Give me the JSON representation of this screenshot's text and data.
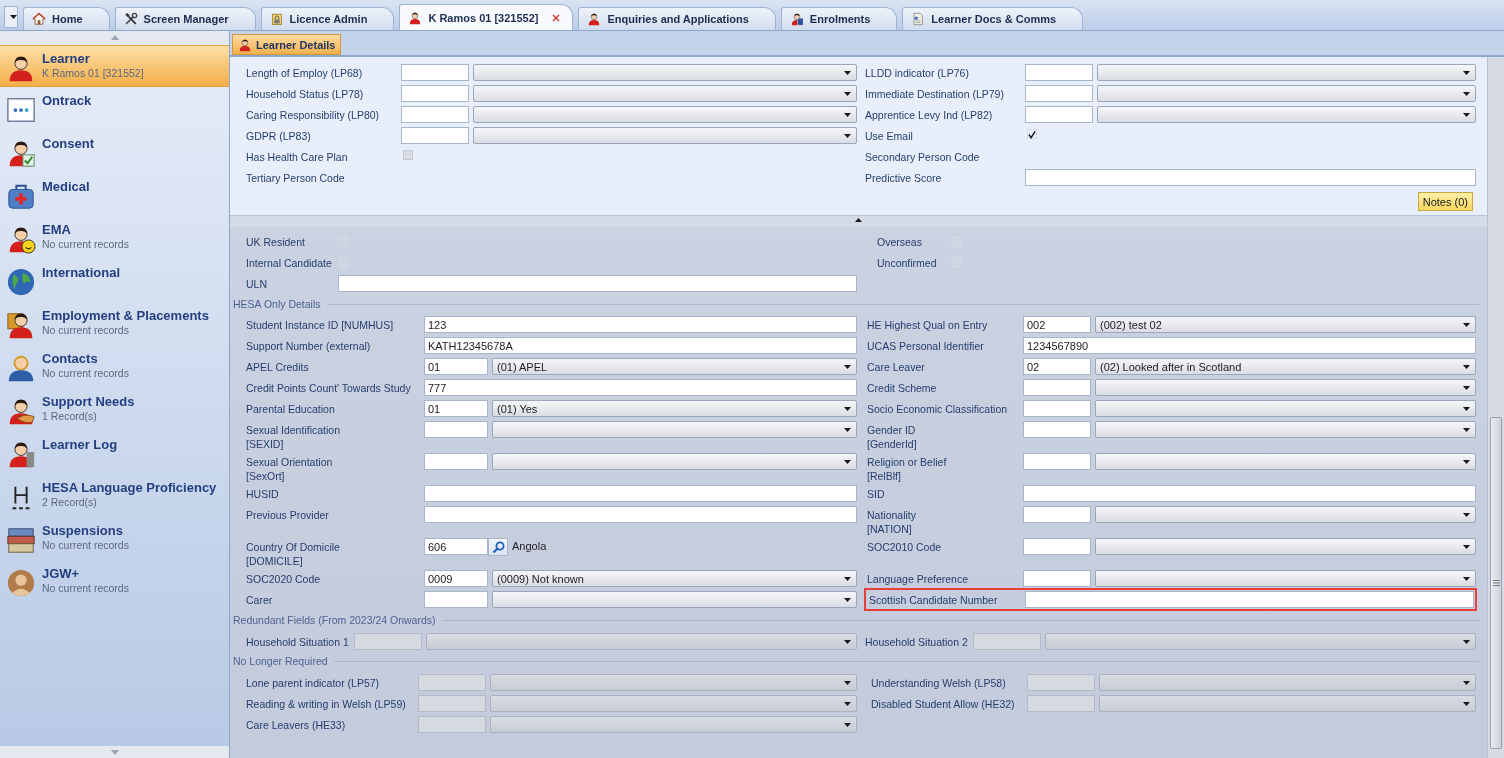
{
  "tab_bar": {
    "tabs": [
      {
        "label": "Home",
        "selected": false,
        "closable": false
      },
      {
        "label": "Screen Manager",
        "selected": false,
        "closable": false
      },
      {
        "label": "Licence Admin",
        "selected": false,
        "closable": false
      },
      {
        "label": "K Ramos 01 [321552]",
        "selected": true,
        "closable": true
      },
      {
        "label": "Enquiries and Applications",
        "selected": false,
        "closable": false
      },
      {
        "label": "Enrolments",
        "selected": false,
        "closable": false
      },
      {
        "label": "Learner Docs & Comms",
        "selected": false,
        "closable": false
      }
    ]
  },
  "sidebar": {
    "items": [
      {
        "title": "Learner",
        "subtitle": "K Ramos 01 [321552]",
        "selected": true
      },
      {
        "title": "Ontrack",
        "selected": false
      },
      {
        "title": "Consent",
        "selected": false
      },
      {
        "title": "Medical",
        "selected": false
      },
      {
        "title": "EMA",
        "subtitle": "No current records",
        "selected": false
      },
      {
        "title": "International",
        "selected": false
      },
      {
        "title": "Employment & Placements",
        "subtitle": "No current records",
        "selected": false
      },
      {
        "title": "Contacts",
        "subtitle": "No current records",
        "selected": false
      },
      {
        "title": "Support Needs",
        "subtitle": "1 Record(s)",
        "selected": false
      },
      {
        "title": "Learner Log",
        "selected": false
      },
      {
        "title": "HESA Language Proficiency",
        "subtitle": "2 Record(s)",
        "selected": false
      },
      {
        "title": "Suspensions",
        "subtitle": "No current records",
        "selected": false
      },
      {
        "title": "JGW+",
        "subtitle": "No current records",
        "selected": false
      }
    ]
  },
  "panel_header": {
    "label": "Learner Details"
  },
  "top_panel": {
    "left": [
      {
        "label": "Length of Employ (LP68)",
        "kind": "combo"
      },
      {
        "label": "Household Status (LP78)",
        "kind": "combo"
      },
      {
        "label": "Caring Responsibility (LP80)",
        "kind": "combo"
      },
      {
        "label": "GDPR (LP83)",
        "kind": "combo"
      },
      {
        "label": "Has Health Care Plan",
        "kind": "checkbox",
        "checked": false,
        "disabled": true
      },
      {
        "label": "Tertiary Person Code",
        "kind": "label"
      }
    ],
    "right": [
      {
        "label": "LLDD indicator (LP76)",
        "kind": "combo"
      },
      {
        "label": "Immediate Destination (LP79)",
        "kind": "combo"
      },
      {
        "label": "Apprentice Levy Ind (LP82)",
        "kind": "combo"
      },
      {
        "label": "Use Email",
        "kind": "checkbox",
        "checked": true
      },
      {
        "label": "Secondary Person Code",
        "kind": "label"
      },
      {
        "label": "Predictive Score",
        "kind": "text"
      }
    ],
    "notes_button": "Notes (0)"
  },
  "residency": {
    "left": [
      {
        "label": "UK Resident",
        "kind": "radio",
        "checked": false
      },
      {
        "label": "Internal Candidate",
        "kind": "radio",
        "checked": false
      },
      {
        "label": "ULN",
        "kind": "text"
      }
    ],
    "right": [
      {
        "label": "Overseas",
        "kind": "radio",
        "checked": false
      },
      {
        "label": "Unconfirmed",
        "kind": "radio",
        "checked": false
      }
    ]
  },
  "sections": [
    {
      "title": "HESA Only Details",
      "left": [
        {
          "label": "Student Instance ID [NUMHUS]",
          "kind": "text",
          "value": "123"
        },
        {
          "label": "Support Number (external)",
          "kind": "text",
          "value": "KATH12345678A"
        },
        {
          "label": "APEL Credits",
          "kind": "combo",
          "code": "01",
          "value": "(01) APEL"
        },
        {
          "label": "Credit Points Count' Towards Study",
          "kind": "text",
          "value": "777"
        },
        {
          "label": "Parental Education",
          "kind": "combo",
          "code": "01",
          "value": "(01) Yes"
        },
        {
          "label": "Sexual Identification\n[SEXID]",
          "kind": "combo"
        },
        {
          "label": "Sexual Orientation\n[SexOrt]",
          "kind": "combo"
        },
        {
          "label": "HUSID",
          "kind": "text"
        },
        {
          "label": "Previous Provider",
          "kind": "text"
        },
        {
          "label": "Country Of Domicile\n[DOMICILE]",
          "kind": "lookup",
          "code": "606",
          "value": "Angola"
        },
        {
          "label": "SOC2020 Code",
          "kind": "combo",
          "code": "0009",
          "value": "(0009) Not known"
        },
        {
          "label": "Carer",
          "kind": "combo"
        }
      ],
      "right": [
        {
          "label": "HE Highest Qual on Entry",
          "kind": "combo",
          "code": "002",
          "value": "(002) test 02",
          "highlighted": false
        },
        {
          "label": "UCAS Personal Identifier",
          "kind": "text",
          "value": "1234567890",
          "highlighted": false
        },
        {
          "label": "Care Leaver",
          "kind": "combo",
          "code": "02",
          "value": "(02) Looked after in Scotland",
          "highlighted": false
        },
        {
          "label": "Credit Scheme",
          "kind": "combo",
          "highlighted": false
        },
        {
          "label": "Socio Economic Classification",
          "kind": "combo",
          "highlighted": false
        },
        {
          "label": "Gender ID\n[GenderId]",
          "kind": "combo",
          "highlighted": false
        },
        {
          "label": "Religion or Belief\n[RelBlf]",
          "kind": "combo",
          "highlighted": false
        },
        {
          "label": "SID",
          "kind": "text",
          "highlighted": false
        },
        {
          "label": "Nationality\n[NATION]",
          "kind": "combo",
          "highlighted": false
        },
        {
          "label": "SOC2010 Code",
          "kind": "combo",
          "highlighted": false
        },
        {
          "label": "Language Preference",
          "kind": "combo",
          "highlighted": false
        },
        {
          "label": "Scottish Candidate Number",
          "kind": "text",
          "highlighted": true
        }
      ]
    },
    {
      "title": "Redundant Fields (From 2023/24 Onwards)",
      "left": [
        {
          "label": "Household Situation 1",
          "kind": "combo",
          "disabled": true
        }
      ],
      "right": [
        {
          "label": "Household Situation 2",
          "kind": "combo",
          "disabled": true
        }
      ]
    },
    {
      "title": "No Longer Required",
      "left": [
        {
          "label": "Lone parent indicator (LP57)",
          "kind": "combo",
          "disabled": true
        },
        {
          "label": "Reading & writing in Welsh (LP59)",
          "kind": "combo",
          "disabled": true
        },
        {
          "label": "Care Leavers (HE33)",
          "kind": "combo",
          "disabled": true
        }
      ],
      "right": [
        {
          "label": "Understanding Welsh (LP58)",
          "kind": "combo",
          "disabled": true
        },
        {
          "label": "Disabled Student Allow (HE32)",
          "kind": "combo",
          "disabled": true
        }
      ]
    }
  ]
}
